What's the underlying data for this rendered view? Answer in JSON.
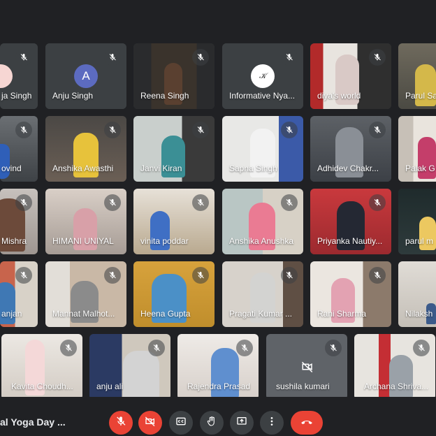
{
  "meeting": {
    "title": "al Yoga Day ..."
  },
  "rows": [
    [
      {
        "name": "ja Singh"
      },
      {
        "name": "Anju Singh",
        "avatar_letter": "A",
        "avatar_color": "#5c6bc0"
      },
      {
        "name": "Reena Singh"
      },
      {
        "name": "Informative Nya..."
      },
      {
        "name": "diya's world"
      },
      {
        "name": "Parul Sa"
      }
    ],
    [
      {
        "name": "ovind"
      },
      {
        "name": "Anshika Awasthi"
      },
      {
        "name": "Janvi Kiran"
      },
      {
        "name": "Sapna Singh"
      },
      {
        "name": "Adhidev Chakr..."
      },
      {
        "name": "Palak G"
      }
    ],
    [
      {
        "name": "Mishra"
      },
      {
        "name": "HIMANI UNIYAL"
      },
      {
        "name": "vinita poddar"
      },
      {
        "name": "Anshika Anushka"
      },
      {
        "name": "Priyanka Nautiy..."
      },
      {
        "name": "parul m"
      }
    ],
    [
      {
        "name": "anjan"
      },
      {
        "name": "Mannat Malhot..."
      },
      {
        "name": "Heena Gupta"
      },
      {
        "name": "Pragati Kumar ..."
      },
      {
        "name": "Rani Sharma"
      },
      {
        "name": "Nilaksh"
      }
    ],
    [
      {
        "name": "Kavita Choudh..."
      },
      {
        "name": "anju ali"
      },
      {
        "name": "Rajendra Prasad"
      },
      {
        "name": "sushila kumari"
      },
      {
        "name": "Archana Shriva..."
      }
    ]
  ],
  "controls": [
    "mic-off",
    "camera-off",
    "captions",
    "raise-hand",
    "present",
    "more",
    "end-call"
  ],
  "colors": {
    "danger": "#ea4335",
    "tile": "#3c4043",
    "background": "#202124"
  }
}
